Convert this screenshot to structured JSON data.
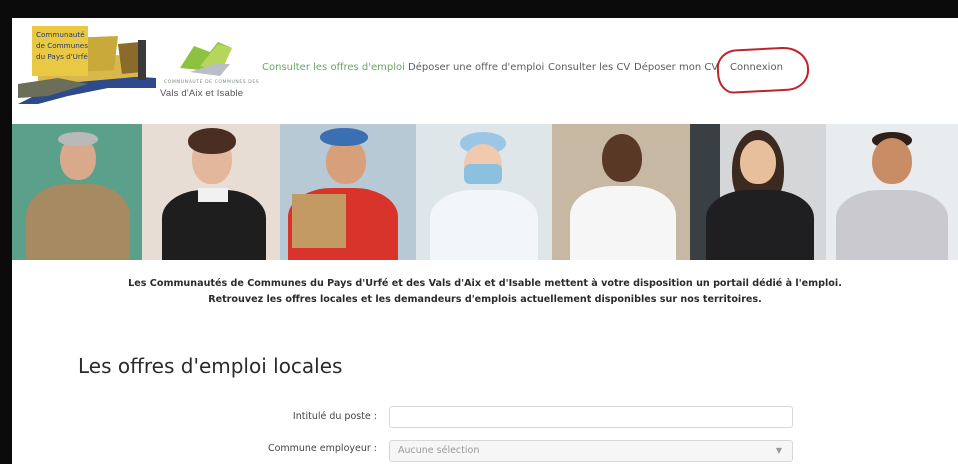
{
  "header": {
    "logo1_text": [
      "Communauté",
      "de Communes",
      "du Pays d'Urfé"
    ],
    "logo2_small": "COMMUNAUTÉ DE COMMUNES DES",
    "logo2_name": "Vals d'Aix et Isable"
  },
  "nav": {
    "items": [
      {
        "label": "Consulter les offres d'emploi"
      },
      {
        "label": "Déposer une offre d'emploi"
      },
      {
        "label": "Consulter les CV"
      },
      {
        "label": "Déposer mon CV"
      },
      {
        "label": "Connexion"
      }
    ]
  },
  "intro": {
    "line1": "Les Communautés de Communes du Pays d'Urfé et des Vals d'Aix et d'Isable mettent à votre disposition un portail dédié à l'emploi.",
    "line2": "Retrouvez les offres locales et les demandeurs d'emplois actuellement disponibles sur nos territoires."
  },
  "section": {
    "title": "Les offres d'emploi locales"
  },
  "form": {
    "job_title_label": "Intitulé du poste :",
    "job_title_value": "",
    "commune_label": "Commune employeur :",
    "commune_placeholder": "Aucune sélection"
  },
  "colors": {
    "nav_active": "#6aa66a",
    "annotation": "#c0242b"
  }
}
